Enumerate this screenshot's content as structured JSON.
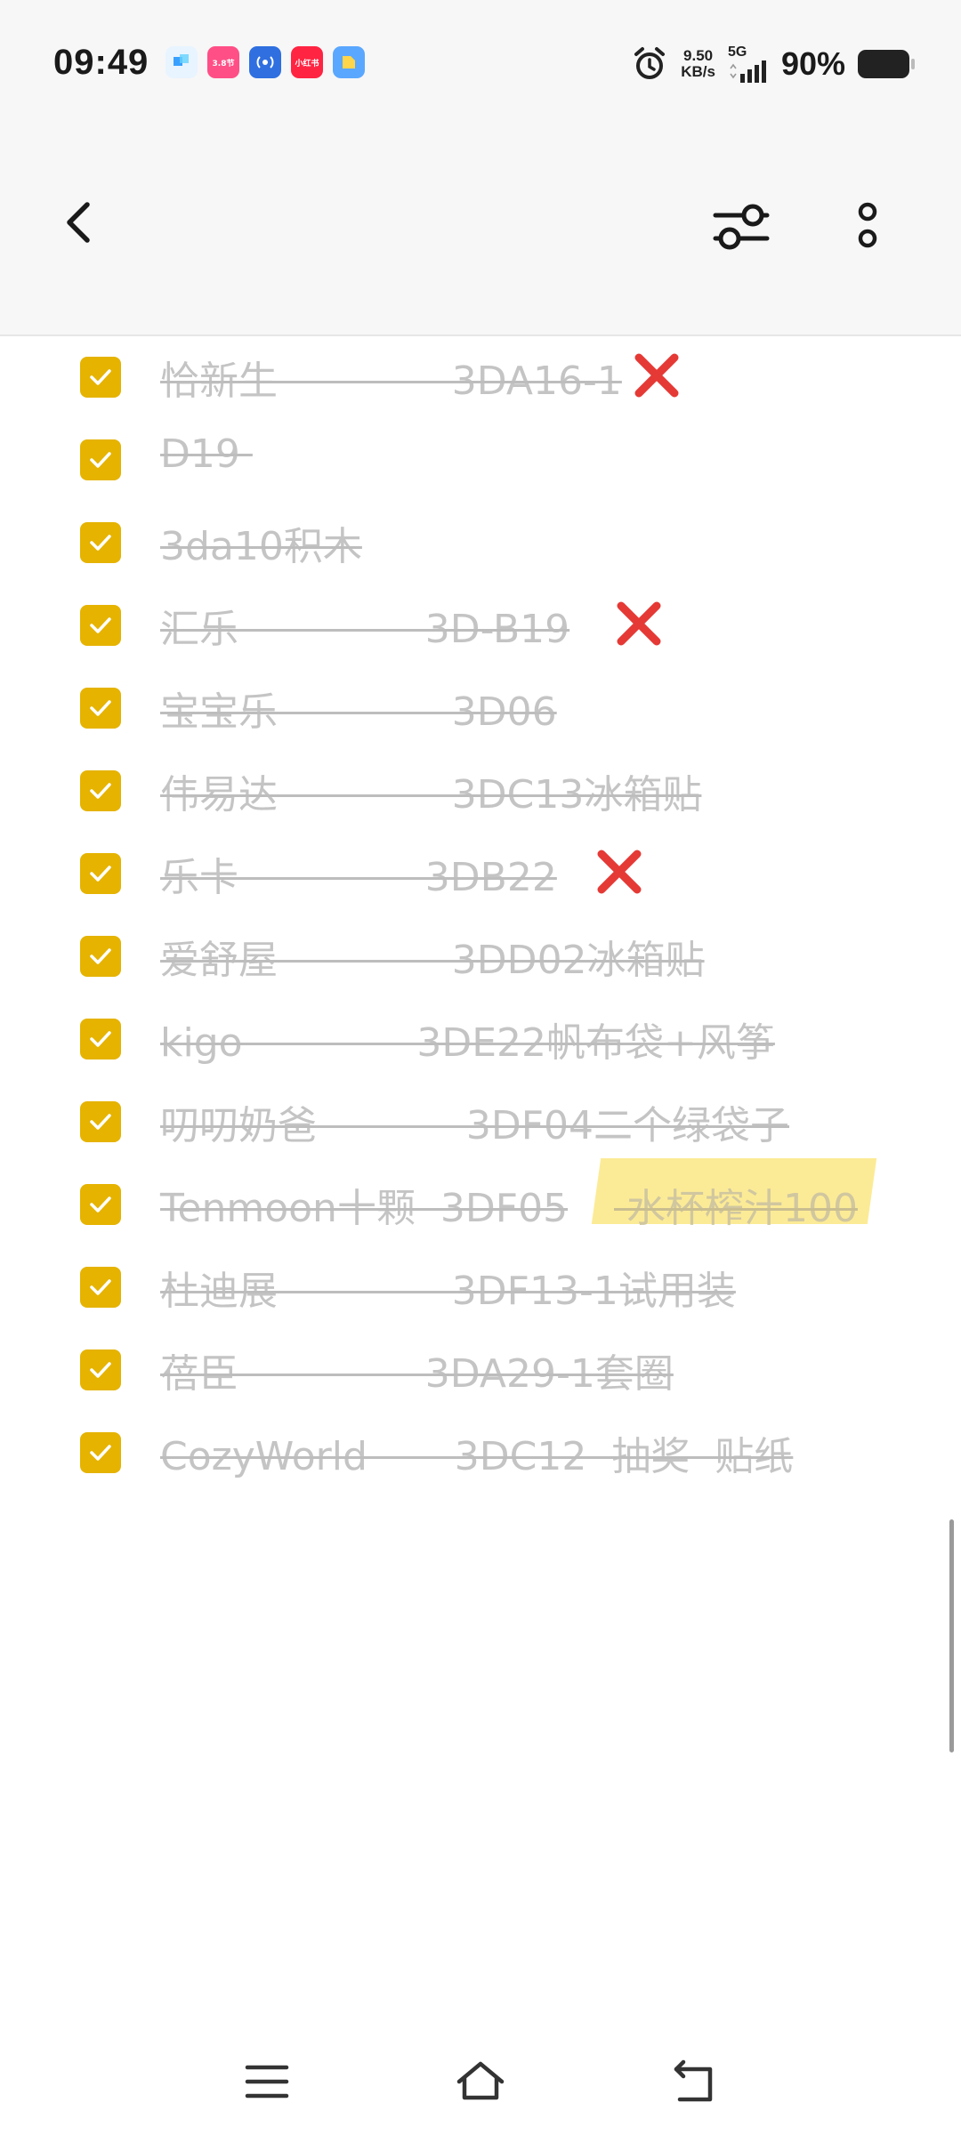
{
  "status_bar": {
    "time": "09:49",
    "net_speed_value": "9.50",
    "net_speed_unit": "KB/s",
    "network_type": "5G",
    "battery": "90%",
    "app_icons": [
      "app-icon-1",
      "app-icon-2",
      "app-icon-3",
      "app-icon-4",
      "app-icon-5"
    ],
    "app_icon_labels": [
      "",
      "3.8节",
      "",
      "小红书",
      ""
    ]
  },
  "toolbar": {
    "back_icon": "chevron-left-icon",
    "filter_icon": "filter-sliders-icon",
    "more_icon": "more-vertical-icon"
  },
  "checklist": {
    "items": [
      {
        "text": "恰新生              3DA16-1",
        "checked": true,
        "mark": "cross"
      },
      {
        "text": "D19 ",
        "checked": true
      },
      {
        "text": "3da10积木",
        "checked": true
      },
      {
        "text": "汇乐               3D-B19",
        "checked": true,
        "mark": "cross"
      },
      {
        "text": "宝宝乐              3D06",
        "checked": true
      },
      {
        "text": "伟易达              3DC13冰箱贴",
        "checked": true
      },
      {
        "text": "乐卡               3DB22",
        "checked": true,
        "mark": "cross"
      },
      {
        "text": "爱舒屋              3DD02冰箱贴",
        "checked": true
      },
      {
        "text": "kigo              3DE22帆布袋+风筝",
        "checked": true
      },
      {
        "text": "叨叨奶爸            3DF04二个绿袋子",
        "checked": true
      },
      {
        "text": "Tenmoon十颗  3DF05",
        "highlight_text": " 水杯榨汁100",
        "checked": true
      },
      {
        "text": "杜迪展              3DF13-1试用装",
        "checked": true
      },
      {
        "text": "蓓臣               3DA29-1套圈",
        "checked": true
      },
      {
        "text": "CozyWorld       3DC12  抽奖  贴纸",
        "checked": true
      }
    ]
  },
  "navbar": {
    "menu_icon": "menu-icon",
    "home_icon": "home-icon",
    "back_icon": "back-arrow-icon"
  },
  "colors": {
    "checkbox": "#e5b300",
    "completed_text": "#c4c4c4",
    "highlight": "#fbe884",
    "cross": "#e53935"
  }
}
